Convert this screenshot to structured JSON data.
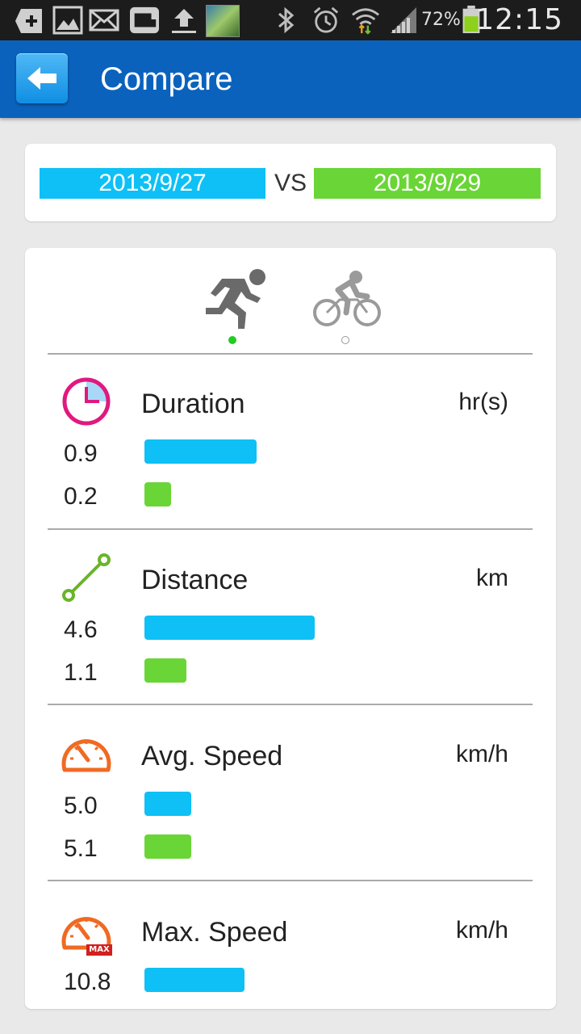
{
  "status_bar": {
    "battery_percent": "72%",
    "time": "12:15",
    "icons": [
      "add-icon",
      "image-icon",
      "mail-icon",
      "app-icon",
      "upload-icon",
      "photo-thumbnail",
      "bluetooth-icon",
      "alarm-icon",
      "wifi-icon",
      "signal-icon",
      "battery-icon"
    ]
  },
  "header": {
    "title": "Compare"
  },
  "compare": {
    "date_a": "2013/9/27",
    "vs": "VS",
    "date_b": "2013/9/29",
    "color_a": "#0ec0f5",
    "color_b": "#6ad536"
  },
  "sports": {
    "items": [
      "running-icon",
      "cycling-icon"
    ],
    "selected": 0
  },
  "metrics": [
    {
      "label": "Duration",
      "unit": "hr(s)",
      "value_a": "0.9",
      "value_b": "0.2",
      "icon": "clock-icon"
    },
    {
      "label": "Distance",
      "unit": "km",
      "value_a": "4.6",
      "value_b": "1.1",
      "icon": "distance-icon"
    },
    {
      "label": "Avg. Speed",
      "unit": "km/h",
      "value_a": "5.0",
      "value_b": "5.1",
      "icon": "speedometer-icon"
    },
    {
      "label": "Max. Speed",
      "unit": "km/h",
      "value_a": "10.8",
      "icon": "max-speedometer-icon",
      "badge": "MAX"
    }
  ]
}
